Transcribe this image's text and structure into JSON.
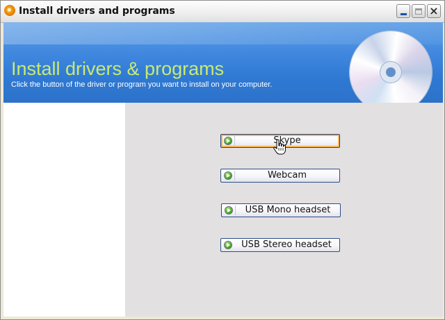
{
  "window": {
    "title": "Install drivers and programs"
  },
  "banner": {
    "title": "Install drivers & programs",
    "subtitle": "Click the button of the driver or program you want to install on your computer.",
    "colors": {
      "background": "#3f87de",
      "title": "#c9ea72"
    },
    "image": "cd-disc"
  },
  "buttons": [
    {
      "label": "Skype",
      "icon": "green-arrow-icon",
      "hovered": true
    },
    {
      "label": "Webcam",
      "icon": "green-arrow-icon",
      "hovered": false
    },
    {
      "label": "USB Mono headset",
      "icon": "green-arrow-icon",
      "hovered": false
    },
    {
      "label": "USB Stereo headset",
      "icon": "green-arrow-icon",
      "hovered": false
    }
  ],
  "cursor": "hand-pointer"
}
